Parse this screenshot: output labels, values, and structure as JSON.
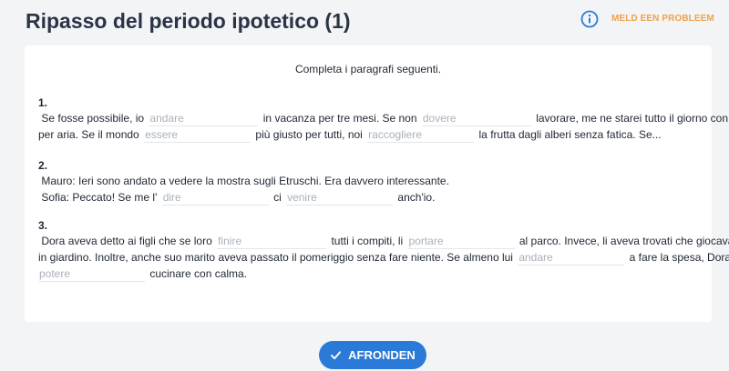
{
  "header": {
    "title": "Ripasso del periodo ipotetico (1)",
    "info_icon": "info-circle-icon",
    "report_label": "MELD EEN PROBLEEM",
    "accent_color": "#2b7ad8",
    "report_color": "#f0a24a"
  },
  "card": {
    "instruction": "Completa i paragrafi seguenti."
  },
  "exercises": [
    {
      "number": "1.",
      "text": [
        "Se fosse possibile, io",
        "in vacanza per tre mesi.  Se non",
        "lavorare, me ne starei tutto il giorno con il naso",
        "per aria.  Se il mondo",
        "più giusto per tutti, noi",
        "la frutta dagli alberi senza fatica. Se..."
      ],
      "blanks": [
        "andare",
        "dovere",
        "essere",
        "raccogliere"
      ]
    },
    {
      "number": "2.",
      "text": [
        "Mauro:  Ieri sono andato a vedere la mostra sugli Etruschi. Era davvero interessante.",
        "Sofia:  Peccato! Se me l'",
        "ci",
        "anch'io."
      ],
      "blanks": [
        "dire",
        "venire"
      ]
    },
    {
      "number": "3.",
      "text": [
        "Dora aveva detto ai figli che se loro",
        "tutti i compiti, li",
        "al parco. Invece, li aveva trovati che giocavano",
        "in giardino. Inoltre, anche suo marito aveva passato il pomeriggio senza fare niente. Se almeno lui",
        "a fare la spesa, Dora",
        "cucinare con calma."
      ],
      "blanks": [
        "finire",
        "portare",
        "andare",
        "potere"
      ]
    }
  ],
  "footer": {
    "button_label": "AFRONDEN",
    "button_icon": "check-icon"
  }
}
